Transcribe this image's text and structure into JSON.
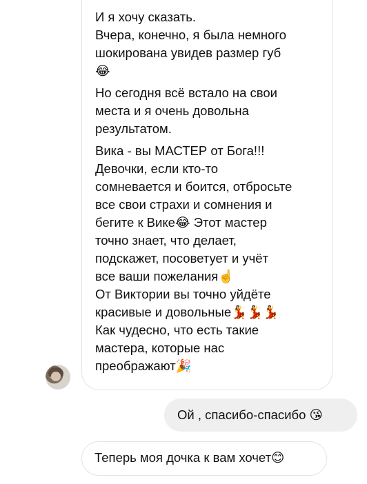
{
  "conversation": {
    "incoming_message": {
      "lines": [
        "И я хочу сказать.",
        "Вчера, конечно, я была немного",
        "шокирована увидев размер губ",
        "😂",
        "Но сегодня всё встало на свои",
        "места и я очень довольна",
        "результатом.",
        "Вика - вы МАСТЕР от Бога!!!",
        "Девочки, если кто-то",
        "сомневается и боится, отбросьте",
        "все свои страхи и сомнения и",
        "бегите к Вике😂 Этот мастер",
        "точно знает, что делает,",
        "подскажет, посоветует и учёт",
        "все ваши пожелания☝️",
        "От Виктории вы точно уйдёте",
        "красивые и довольные💃💃💃",
        "Как чудесно, что есть такие",
        "мастера, которые нас",
        "преображают🎉"
      ]
    },
    "outgoing_message": {
      "text": "Ой , спасибо-спасибо 😘"
    },
    "bottom_message": {
      "text": "Теперь моя дочка к вам хочет😊"
    }
  }
}
